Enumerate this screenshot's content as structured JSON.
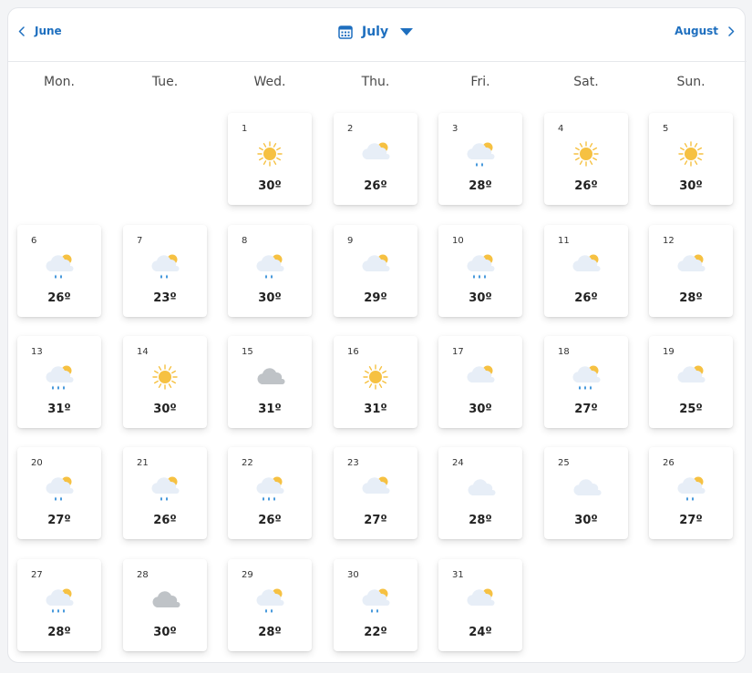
{
  "nav": {
    "prev_label": "June",
    "current_month": "July",
    "next_label": "August"
  },
  "weekdays": [
    "Mon.",
    "Tue.",
    "Wed.",
    "Thu.",
    "Fri.",
    "Sat.",
    "Sun."
  ],
  "colors": {
    "accent": "#1e6fbf",
    "sun": "#f6c142",
    "cloud": "#e7eef7",
    "grey_cloud": "#bfc3c7",
    "rain": "#2f8cd7"
  },
  "days": [
    {
      "day": "1",
      "temp": "30º",
      "icon": "sun"
    },
    {
      "day": "2",
      "temp": "26º",
      "icon": "cloud-sun"
    },
    {
      "day": "3",
      "temp": "28º",
      "icon": "cloud-sun-rain-2"
    },
    {
      "day": "4",
      "temp": "26º",
      "icon": "sun"
    },
    {
      "day": "5",
      "temp": "30º",
      "icon": "sun"
    },
    {
      "day": "6",
      "temp": "26º",
      "icon": "cloud-sun-rain-2"
    },
    {
      "day": "7",
      "temp": "23º",
      "icon": "cloud-sun-rain-2"
    },
    {
      "day": "8",
      "temp": "30º",
      "icon": "cloud-sun-rain-2"
    },
    {
      "day": "9",
      "temp": "29º",
      "icon": "cloud-sun"
    },
    {
      "day": "10",
      "temp": "30º",
      "icon": "cloud-sun-rain-3"
    },
    {
      "day": "11",
      "temp": "26º",
      "icon": "cloud-sun"
    },
    {
      "day": "12",
      "temp": "28º",
      "icon": "cloud-sun"
    },
    {
      "day": "13",
      "temp": "31º",
      "icon": "cloud-sun-rain-3"
    },
    {
      "day": "14",
      "temp": "30º",
      "icon": "sun"
    },
    {
      "day": "15",
      "temp": "31º",
      "icon": "grey-cloud"
    },
    {
      "day": "16",
      "temp": "31º",
      "icon": "sun"
    },
    {
      "day": "17",
      "temp": "30º",
      "icon": "cloud-sun"
    },
    {
      "day": "18",
      "temp": "27º",
      "icon": "cloud-sun-rain-3"
    },
    {
      "day": "19",
      "temp": "25º",
      "icon": "cloud-sun"
    },
    {
      "day": "20",
      "temp": "27º",
      "icon": "cloud-sun-rain-2"
    },
    {
      "day": "21",
      "temp": "26º",
      "icon": "cloud-sun-rain-2"
    },
    {
      "day": "22",
      "temp": "26º",
      "icon": "cloud-sun-rain-3"
    },
    {
      "day": "23",
      "temp": "27º",
      "icon": "cloud-sun"
    },
    {
      "day": "24",
      "temp": "28º",
      "icon": "cloud"
    },
    {
      "day": "25",
      "temp": "30º",
      "icon": "cloud"
    },
    {
      "day": "26",
      "temp": "27º",
      "icon": "cloud-sun-rain-2"
    },
    {
      "day": "27",
      "temp": "28º",
      "icon": "cloud-sun-rain-3"
    },
    {
      "day": "28",
      "temp": "30º",
      "icon": "grey-cloud"
    },
    {
      "day": "29",
      "temp": "28º",
      "icon": "cloud-sun-rain-2"
    },
    {
      "day": "30",
      "temp": "22º",
      "icon": "cloud-sun-rain-2"
    },
    {
      "day": "31",
      "temp": "24º",
      "icon": "cloud-sun"
    }
  ]
}
